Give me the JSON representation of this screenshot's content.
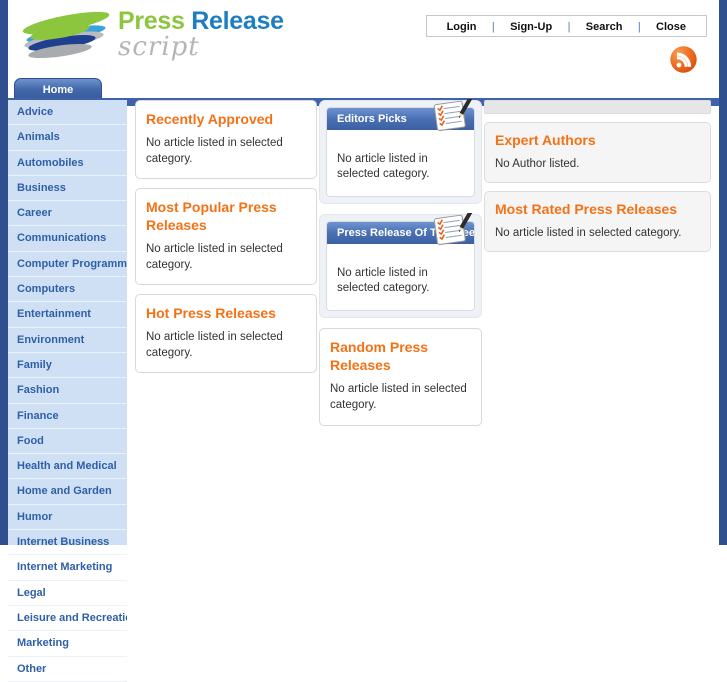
{
  "site": {
    "logo_line1_a": "Press",
    "logo_line1_b": "Release",
    "logo_line2": "script"
  },
  "topnav": {
    "items": [
      {
        "label": "Login"
      },
      {
        "label": "Sign-Up"
      },
      {
        "label": "Search"
      },
      {
        "label": "Close"
      }
    ],
    "separator": "|",
    "rss_icon": "rss-icon"
  },
  "tabs": [
    {
      "label": "Home",
      "active": true
    }
  ],
  "sidebar": {
    "items": [
      {
        "label": "Advice"
      },
      {
        "label": "Animals"
      },
      {
        "label": "Automobiles"
      },
      {
        "label": "Business"
      },
      {
        "label": "Career"
      },
      {
        "label": "Communications"
      },
      {
        "label": "Computer Programming"
      },
      {
        "label": "Computers"
      },
      {
        "label": "Entertainment"
      },
      {
        "label": "Environment"
      },
      {
        "label": "Family"
      },
      {
        "label": "Fashion"
      },
      {
        "label": "Finance"
      },
      {
        "label": "Food"
      },
      {
        "label": "Health and Medical"
      },
      {
        "label": "Home and Garden"
      },
      {
        "label": "Humor"
      },
      {
        "label": "Internet Business"
      },
      {
        "label": "Internet Marketing"
      },
      {
        "label": "Legal"
      },
      {
        "label": "Leisure and Recreation"
      },
      {
        "label": "Marketing"
      },
      {
        "label": "Other"
      }
    ]
  },
  "column1": {
    "panels": [
      {
        "title": "Recently Approved",
        "body": "No article listed in selected category."
      },
      {
        "title": "Most Popular Press Releases",
        "body": "No article listed in selected category."
      },
      {
        "title": "Hot Press Releases",
        "body": "No article listed in selected category."
      }
    ]
  },
  "column2": {
    "boxes": [
      {
        "title": "Editors Picks",
        "body": "No article listed in selected category.",
        "icon": "notepad-pencil-icon"
      },
      {
        "title": "Press Release Of The Week",
        "body": "No article listed in selected category.",
        "icon": "notepad-pencil-icon"
      }
    ],
    "random_panel": {
      "title": "Random Press Releases",
      "body": "No article listed in selected category."
    }
  },
  "column3": {
    "panels": [
      {
        "title": "Expert Authors",
        "body": "No Author listed."
      },
      {
        "title": "Most Rated Press Releases",
        "body": "No article listed in selected category."
      }
    ]
  },
  "colors": {
    "accent_orange": "#f47216",
    "brand_blue": "#1f7ec1",
    "brand_green": "#8cc63e",
    "nav_blue": "#3f63ab",
    "sidebar_bg": "#cfe0f5",
    "frame_navy": "#2f4f8f"
  }
}
